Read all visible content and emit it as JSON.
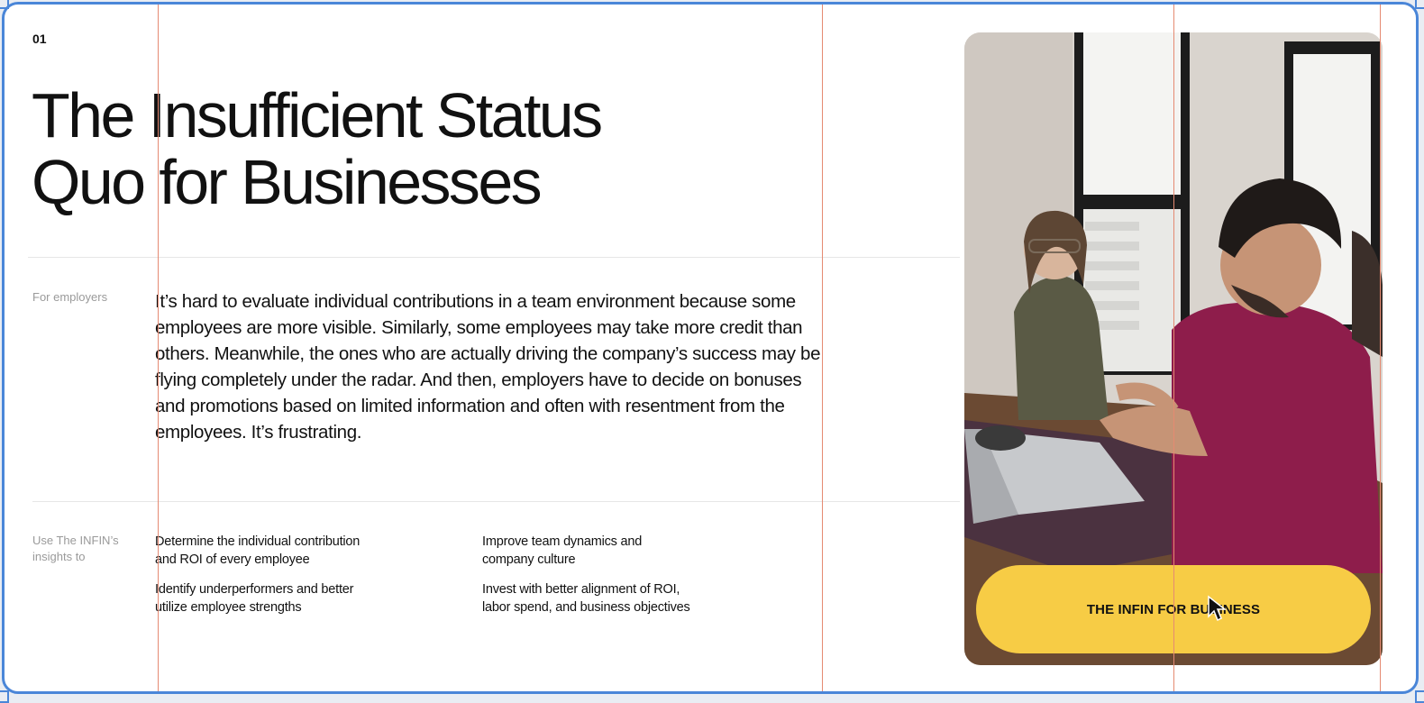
{
  "section": {
    "number": "01"
  },
  "hero": {
    "title_line1": "The Insufficient Status",
    "title_line2": "Quo for Businesses"
  },
  "employers": {
    "label": "For employers",
    "body": "It’s hard to evaluate individual contributions in a team environment because some employees are more visible. Similarly, some employees may take more credit than others. Meanwhile, the ones who are actually driving the company’s success may be flying completely under the radar. And then, employers have to decide on bonuses and promotions based on limited information and often with resentment from the employees. It’s frustrating."
  },
  "insights": {
    "label_line1": "Use The INFIN’s",
    "label_line2": "insights to",
    "items": [
      {
        "line1": "Determine the individual contribution",
        "line2": "and ROI of every employee"
      },
      {
        "line1": "Improve team dynamics and",
        "line2": "company culture"
      },
      {
        "line1": "Identify underperformers and better",
        "line2": "utilize employee strengths"
      },
      {
        "line1": "Invest with better alignment of ROI,",
        "line2": "labor spend, and business objectives"
      }
    ]
  },
  "cta": {
    "label": "THE INFIN FOR BUSINESS"
  },
  "colors": {
    "accent": "#f7cc45",
    "frame": "#4a86d8",
    "guide": "#e58a72"
  },
  "icons": {
    "cursor": "cursor-arrow-icon"
  }
}
